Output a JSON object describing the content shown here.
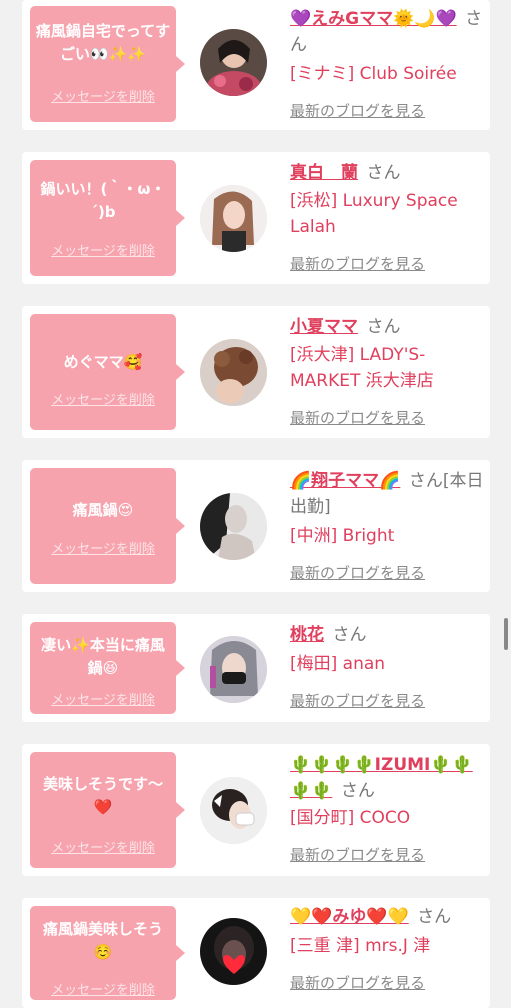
{
  "messages": [
    {
      "message": "痛風鍋自宅でってすごい👀✨✨",
      "delete_label": "メッセージを削除",
      "name": "💜えみGママ🌞🌙💜",
      "honorific": "さん",
      "shop": "[ミナミ] Club Soirée",
      "blog_link": "最新のブログを見る"
    },
    {
      "message": "鍋いい！(｀・ω・´)b",
      "delete_label": "メッセージを削除",
      "name": "真白　蘭",
      "honorific": "さん",
      "shop": "[浜松] Luxury Space Lalah",
      "blog_link": "最新のブログを見る"
    },
    {
      "message": "めぐママ🥰",
      "delete_label": "メッセージを削除",
      "name": "小夏ママ",
      "honorific": "さん",
      "shop": "[浜大津] LADY'S-MARKET 浜大津店",
      "blog_link": "最新のブログを見る"
    },
    {
      "message": "痛風鍋😍",
      "delete_label": "メッセージを削除",
      "name": "🌈翔子ママ🌈",
      "honorific": "さん[本日出勤]",
      "shop": "[中洲] Bright",
      "blog_link": "最新のブログを見る"
    },
    {
      "message": "凄い✨本当に痛風鍋😆",
      "delete_label": "メッセージを削除",
      "name": "桃花",
      "honorific": "さん",
      "shop": "[梅田] anan",
      "blog_link": "最新のブログを見る"
    },
    {
      "message": "美味しそうです〜❤️",
      "delete_label": "メッセージを削除",
      "name": "🌵🌵🌵🌵IZUMI🌵🌵🌵🌵",
      "honorific": "さん",
      "shop": "[国分町] COCO",
      "blog_link": "最新のブログを見る"
    },
    {
      "message": "痛風鍋美味しそう☺️",
      "delete_label": "メッセージを削除",
      "name": "💛❤️みゆ❤️💛",
      "honorific": "さん",
      "shop": "[三重 津] mrs.J 津",
      "blog_link": "最新のブログを見る"
    }
  ]
}
